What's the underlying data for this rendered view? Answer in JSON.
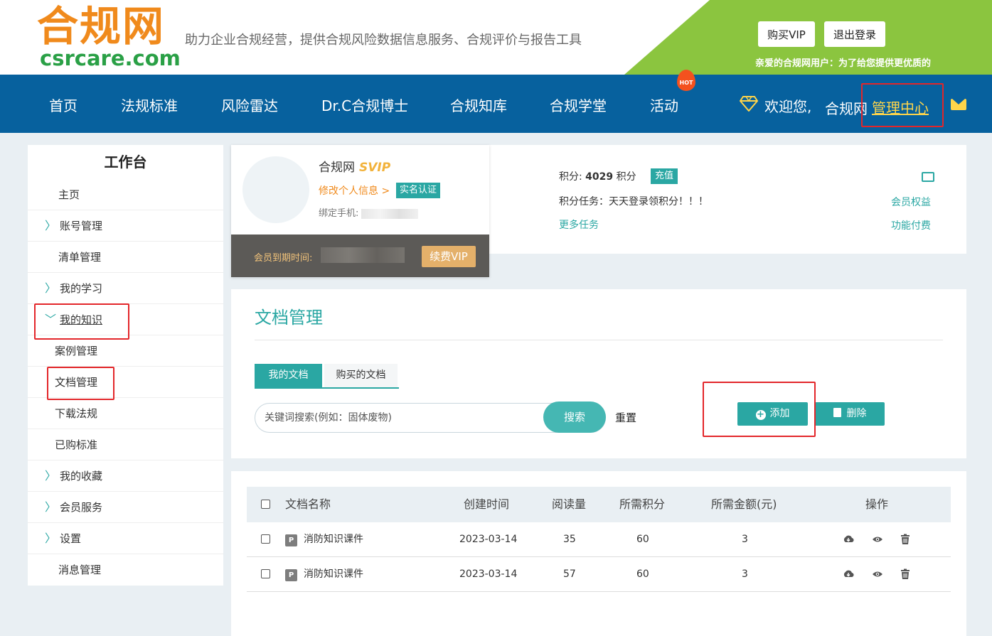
{
  "header": {
    "logo_cn": "合规网",
    "logo_en": "csrcare.com",
    "slogan": "助力企业合规经营，提供合规风险数据信息服务、合规评价与报告工具",
    "buy_vip": "购买VIP",
    "logout": "退出登录",
    "marquee": "亲爱的合规网用户：为了给您提供更优质的"
  },
  "nav": {
    "items": [
      "首页",
      "法规标准",
      "风险雷达",
      "Dr.C合规博士",
      "合规知库",
      "合规学堂",
      "活动"
    ],
    "hot_badge": "HOT",
    "welcome": "欢迎您,",
    "username": "合规网",
    "management_center": "管理中心"
  },
  "sidebar": {
    "title": "工作台",
    "items": [
      {
        "label": "主页",
        "chevron": false
      },
      {
        "label": "账号管理",
        "chevron": true
      },
      {
        "label": "清单管理",
        "chevron": false
      },
      {
        "label": "我的学习",
        "chevron": true
      },
      {
        "label": "我的知识",
        "chevron": true
      },
      {
        "label": "案例管理",
        "chevron": false
      },
      {
        "label": "文档管理",
        "chevron": false
      },
      {
        "label": "下载法规",
        "chevron": false
      },
      {
        "label": "已购标准",
        "chevron": false
      },
      {
        "label": "我的收藏",
        "chevron": true
      },
      {
        "label": "会员服务",
        "chevron": true
      },
      {
        "label": "设置",
        "chevron": true
      },
      {
        "label": "消息管理",
        "chevron": false
      }
    ]
  },
  "profile": {
    "name": "合规网",
    "badge": "SVIP",
    "edit_info": "修改个人信息 >",
    "verified": "实名认证",
    "phone_label": "绑定手机:",
    "expire_label": "会员到期时间:",
    "renew": "续费VIP"
  },
  "points": {
    "label": "积分:",
    "value": "4029",
    "unit": "积分",
    "recharge": "充值",
    "task": "积分任务：天天登录领积分！！！",
    "more_tasks": "更多任务",
    "member_benefits": "会员权益",
    "paid_features": "功能付费"
  },
  "docs": {
    "title": "文档管理",
    "tab_mine": "我的文档",
    "tab_bought": "购买的文档",
    "search_placeholder": "关键词搜索(例如：固体废物)",
    "search_btn": "搜索",
    "reset": "重置",
    "add": "添加",
    "delete": "删除"
  },
  "table": {
    "headers": {
      "name": "文档名称",
      "created": "创建时间",
      "views": "阅读量",
      "points": "所需积分",
      "amount": "所需金额(元)",
      "actions": "操作"
    },
    "rows": [
      {
        "name": "消防知识课件",
        "created": "2023-03-14",
        "views": "35",
        "points": "60",
        "amount": "3"
      },
      {
        "name": "消防知识课件",
        "created": "2023-03-14",
        "views": "57",
        "points": "60",
        "amount": "3"
      }
    ]
  },
  "colors": {
    "brand_teal": "#2aa7a3",
    "nav_blue": "#07619e",
    "header_green": "#8bc53f",
    "logo_orange": "#f08a1c",
    "highlight_red": "#e3262a"
  }
}
